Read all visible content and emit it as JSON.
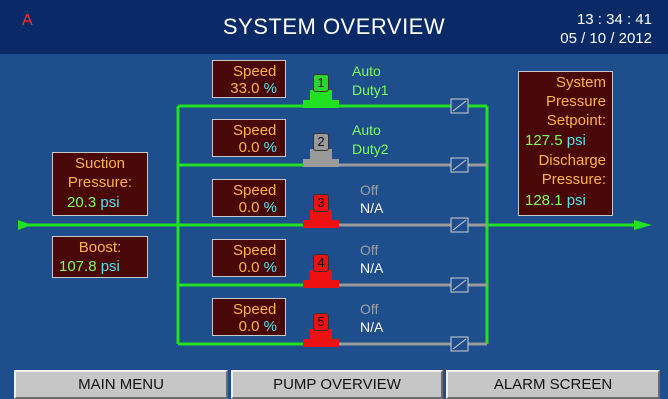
{
  "header": {
    "alarm_indicator": "A",
    "title": "SYSTEM OVERVIEW",
    "time": "13 : 34 : 41",
    "date": "05 / 10 / 2012"
  },
  "suction": {
    "label_line1": "Suction",
    "label_line2": "Pressure:",
    "value": "20.3",
    "unit": "psi"
  },
  "boost": {
    "label": "Boost:",
    "value": "107.8",
    "unit": "psi"
  },
  "system": {
    "label_line1": "System",
    "label_line2": "Pressure",
    "label_line3": "Setpoint:",
    "setpoint_value": "127.5",
    "setpoint_unit": "psi",
    "discharge_line1": "Discharge",
    "discharge_line2": "Pressure:",
    "discharge_value": "128.1",
    "discharge_unit": "psi"
  },
  "pumps": [
    {
      "number": "1",
      "speed_label": "Speed",
      "speed_value": "33.0",
      "speed_unit": "%",
      "mode": "Auto",
      "role": "Duty1",
      "badge_color": "#2bd62b",
      "line_color": "#22e022"
    },
    {
      "number": "2",
      "speed_label": "Speed",
      "speed_value": "0.0",
      "speed_unit": "%",
      "mode": "Auto",
      "role": "Duty2",
      "badge_color": "#9a9a9a",
      "line_color": "#9a9a9a"
    },
    {
      "number": "3",
      "speed_label": "Speed",
      "speed_value": "0.0",
      "speed_unit": "%",
      "mode": "Off",
      "role": "N/A",
      "badge_color": "#ee1111",
      "line_color": "#9a9a9a"
    },
    {
      "number": "4",
      "speed_label": "Speed",
      "speed_value": "0.0",
      "speed_unit": "%",
      "mode": "Off",
      "role": "N/A",
      "badge_color": "#ee1111",
      "line_color": "#9a9a9a"
    },
    {
      "number": "5",
      "speed_label": "Speed",
      "speed_value": "0.0",
      "speed_unit": "%",
      "mode": "Off",
      "role": "N/A",
      "badge_color": "#ee1111",
      "line_color": "#9a9a9a"
    }
  ],
  "buttons": {
    "main_menu": "MAIN MENU",
    "pump_overview": "PUMP OVERVIEW",
    "alarm_screen": "ALARM SCREEN"
  },
  "colors": {
    "background": "#1f4e8c",
    "header": "#0a2a67",
    "active_pipe": "#22e022",
    "inactive_pipe": "#9a9a9a",
    "fault": "#ee1111",
    "box_bg": "#4a0707"
  }
}
